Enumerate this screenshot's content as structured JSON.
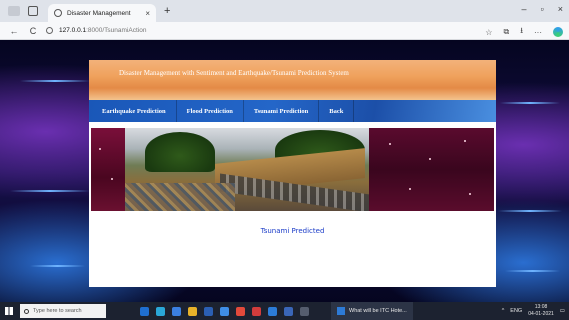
{
  "browser": {
    "tab_title": "Disaster Management",
    "tab_close": "×",
    "new_tab": "+",
    "url_host": "127.0.0.1",
    "url_path": ":8000/TsunamiAction",
    "back": "←",
    "refresh": "C",
    "window_controls": {
      "minimize": "–",
      "restore": "▫",
      "close": "×"
    },
    "right_icons": {
      "favorite": "☆",
      "collections": "⧉",
      "downloads": "⭳",
      "more": "···"
    }
  },
  "site": {
    "title": "Disaster Management with Sentiment and Earthquake/Tsunami Prediction System",
    "nav": [
      {
        "label": "Earthquake Prediction"
      },
      {
        "label": "Flood Prediction"
      },
      {
        "label": "Tsunami Prediction"
      },
      {
        "label": "Back"
      }
    ],
    "result_text": "Tsunami Predicted"
  },
  "taskbar": {
    "search_placeholder": "Type here to search",
    "active_window": "What will be ITC Hote...",
    "tray": {
      "lang": "ENG",
      "time": "13:08",
      "date": "04-01-2021"
    }
  },
  "colors": {
    "header_orange": "#f0a25d",
    "nav_blue": "#2466c8",
    "result_blue": "#1b3cc8"
  }
}
